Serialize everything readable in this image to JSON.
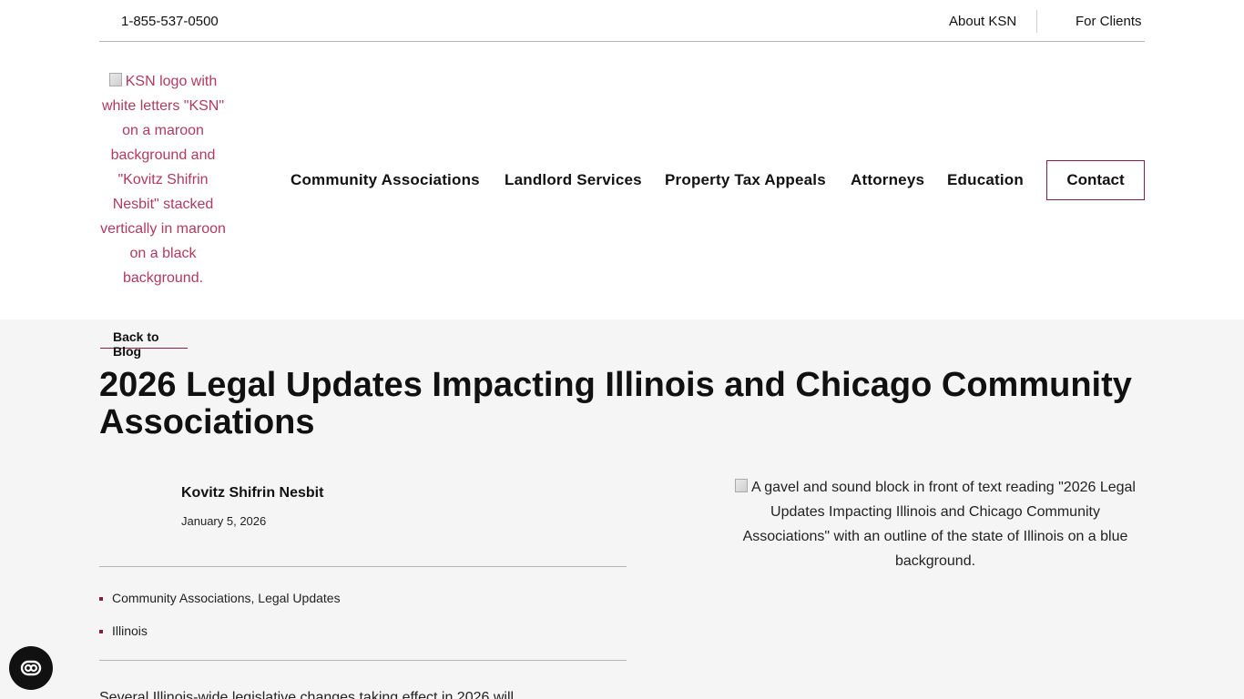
{
  "topbar": {
    "phone": "1-855-537-0500",
    "about": "About KSN",
    "clients": "For Clients"
  },
  "logo": {
    "alt": "KSN logo with white letters \"KSN\" on a maroon background and \"Kovitz Shifrin Nesbit\" stacked vertically in maroon on a black background."
  },
  "nav": {
    "items": [
      "Community Associations",
      "Landlord Services",
      "Property Tax Appeals",
      "Attorneys",
      "Education"
    ],
    "contact": "Contact"
  },
  "post": {
    "back": "Back to Blog",
    "title": "2026 Legal Updates Impacting Illinois and Chicago Community Associations",
    "author": "Kovitz Shifrin Nesbit",
    "date": "January 5, 2026",
    "categories": "Community Associations, Legal Updates",
    "tag": "Illinois",
    "image_alt": "A gavel and sound block in front of text reading \"2026 Legal Updates Impacting Illinois and Chicago Community Associations\" with an outline of the state of Illinois on a blue background.",
    "excerpt": "Several Illinois-wide legislative changes taking effect in 2026 will"
  },
  "colors": {
    "accent": "#8c1d40",
    "link": "#b03a5e"
  },
  "icons": {
    "accessibility": "accessibility-toggle-icon"
  }
}
